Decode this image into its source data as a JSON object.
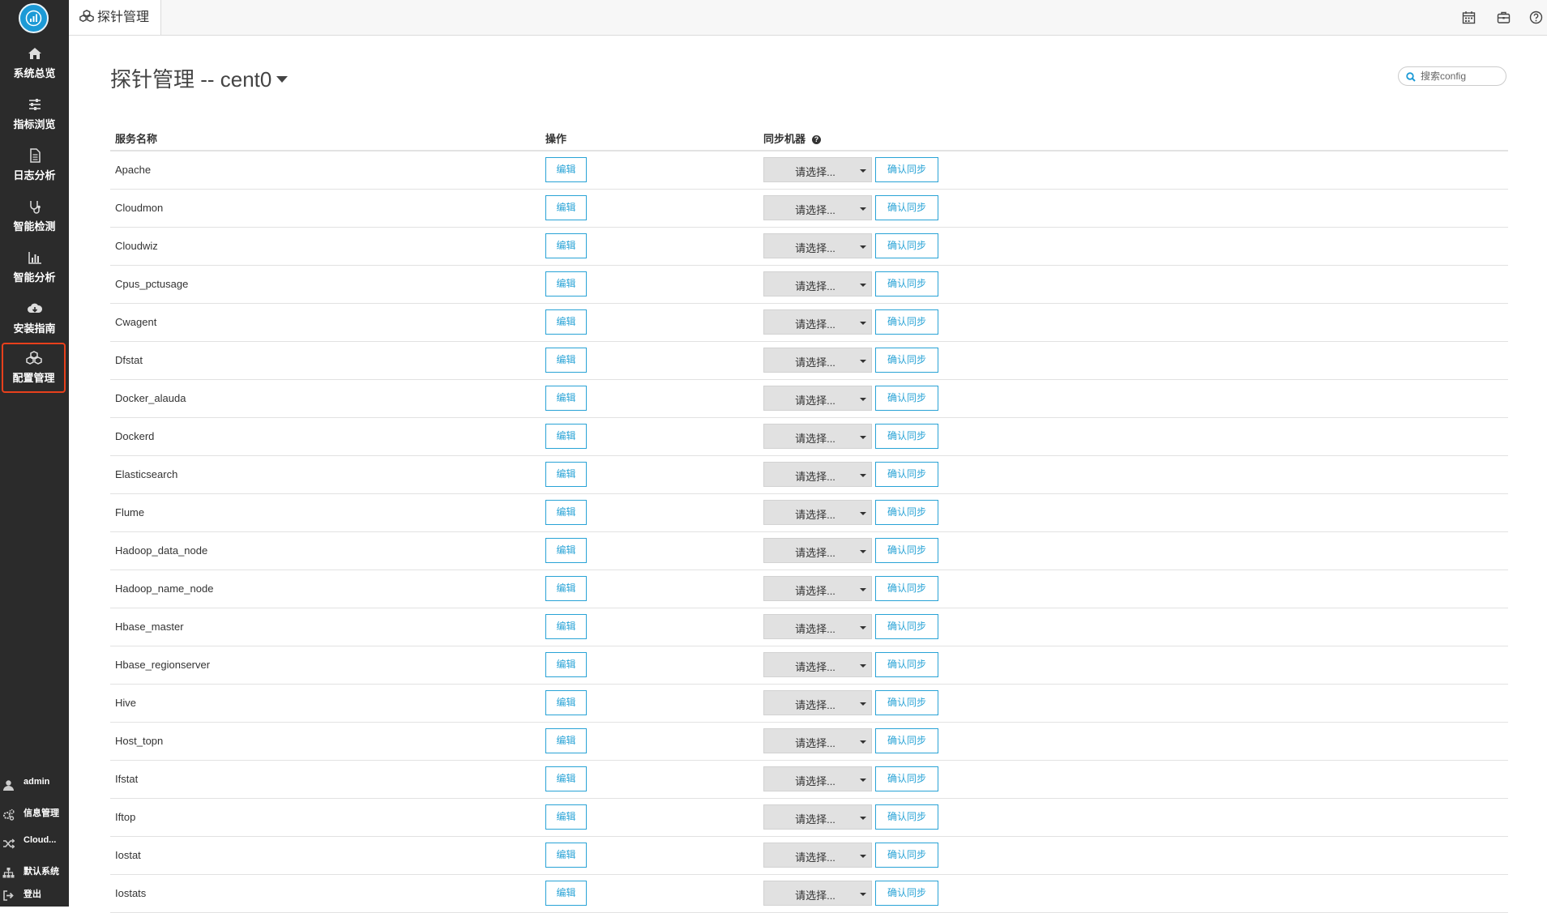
{
  "sidebar": {
    "logo": "logo-icon",
    "items": [
      {
        "label": "系统总览",
        "icon": "home-icon"
      },
      {
        "label": "指标浏览",
        "icon": "sliders-icon"
      },
      {
        "label": "日志分析",
        "icon": "document-icon"
      },
      {
        "label": "智能检测",
        "icon": "stethoscope-icon"
      },
      {
        "label": "智能分析",
        "icon": "bar-chart-icon"
      },
      {
        "label": "安装指南",
        "icon": "cloud-download-icon"
      },
      {
        "label": "配置管理",
        "icon": "cubes-icon",
        "active": true
      }
    ],
    "bottom": [
      {
        "label": "admin",
        "icon": "user-icon"
      },
      {
        "label": "信息管理",
        "icon": "cogs-icon"
      },
      {
        "label": "Cloud...",
        "icon": "shuffle-icon"
      },
      {
        "label": "默认系统",
        "icon": "sitemap-icon"
      },
      {
        "label": "登出",
        "icon": "sign-out-icon"
      }
    ]
  },
  "topbar": {
    "tab_label": "探针管理",
    "icons": [
      "calendar-icon",
      "briefcase-icon",
      "help-icon"
    ]
  },
  "page": {
    "title": "探针管理 -- cent0",
    "search_placeholder": "搜索config"
  },
  "table": {
    "headers": {
      "name": "服务名称",
      "action": "操作",
      "sync": "同步机器"
    },
    "edit_label": "编辑",
    "select_label": "请选择...",
    "sync_label": "确认同步",
    "rows": [
      "Apache",
      "Cloudmon",
      "Cloudwiz",
      "Cpus_pctusage",
      "Cwagent",
      "Dfstat",
      "Docker_alauda",
      "Dockerd",
      "Elasticsearch",
      "Flume",
      "Hadoop_data_node",
      "Hadoop_name_node",
      "Hbase_master",
      "Hbase_regionserver",
      "Hive",
      "Host_topn",
      "Ifstat",
      "Iftop",
      "Iostat",
      "Iostats"
    ]
  },
  "colors": {
    "accent": "#29a3d6",
    "sidebar": "#2b2b2b",
    "active_border": "#e8401c"
  }
}
